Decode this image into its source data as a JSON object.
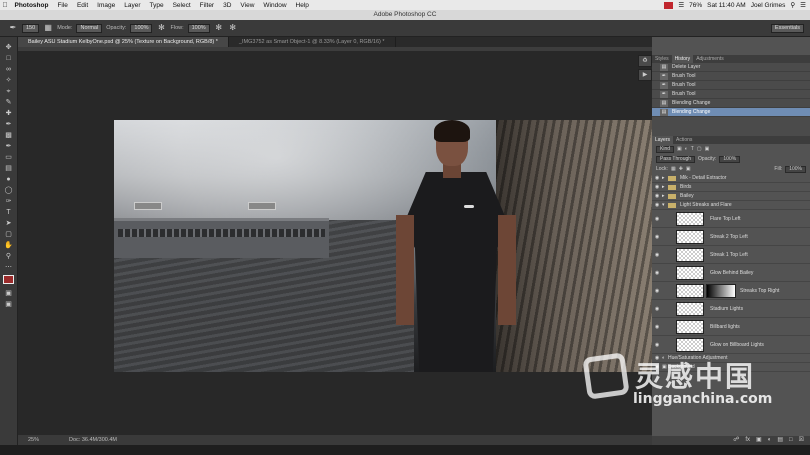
{
  "menubar": {
    "apple_icon": "apple-logo-icon",
    "items": [
      "Photoshop",
      "File",
      "Edit",
      "Image",
      "Layer",
      "Type",
      "Select",
      "Filter",
      "3D",
      "View",
      "Window",
      "Help"
    ],
    "status": {
      "battery": "76%",
      "clock": "Sat 11:40 AM",
      "user": "Joel Grimes"
    }
  },
  "window": {
    "title": "Adobe Photoshop CC"
  },
  "options": {
    "brush_size": "150",
    "mode_label": "Mode:",
    "mode_value": "Normal",
    "opacity_label": "Opacity:",
    "opacity_value": "100%",
    "flow_label": "Flow:",
    "flow_value": "100%",
    "workspace": "Essentials"
  },
  "tabs": [
    {
      "label": "Bailey ASU Stadium KelbyOne.psd @ 25% (Texture on Background, RGB/8) *",
      "active": true
    },
    {
      "label": "_IMG3752 as Smart Object-1 @ 8.33% (Layer 0, RGB/16) *",
      "active": false
    }
  ],
  "status_bar": {
    "zoom": "25%",
    "doc": "Doc: 36.4M/300.4M"
  },
  "history_panel": {
    "tabs": [
      "Styles",
      "History",
      "Adjustments"
    ],
    "active_tab": "History",
    "items": [
      {
        "label": "Delete Layer",
        "icon": "layer-icon"
      },
      {
        "label": "Brush Tool",
        "icon": "brush-icon"
      },
      {
        "label": "Brush Tool",
        "icon": "brush-icon"
      },
      {
        "label": "Brush Tool",
        "icon": "brush-icon"
      },
      {
        "label": "Blending Change",
        "icon": "layer-icon"
      },
      {
        "label": "Blending Change",
        "icon": "layer-icon",
        "selected": true
      }
    ]
  },
  "layers_panel": {
    "tabs": [
      "Layers",
      "Actions"
    ],
    "active_tab": "Layers",
    "kind": "Kind",
    "blend_mode": "Pass Through",
    "opacity_label": "Opacity:",
    "opacity_value": "100%",
    "lock_label": "Lock:",
    "fill_label": "Fill:",
    "fill_value": "100%",
    "groups": [
      {
        "label": "Mik - Detail Extractor"
      },
      {
        "label": "Birds"
      },
      {
        "label": "Bailey"
      },
      {
        "label": "Light Streaks and Flare",
        "open": true
      }
    ],
    "layers": [
      {
        "label": "Flare Top Left",
        "has_mask": false
      },
      {
        "label": "Streak 2 Top Left",
        "has_mask": false
      },
      {
        "label": "Streak 1 Top Left",
        "has_mask": false
      },
      {
        "label": "Glow Behind Bailey",
        "has_mask": false
      },
      {
        "label": "Streaks Top Right",
        "has_mask": true
      },
      {
        "label": "Stadium Lights",
        "has_mask": false
      },
      {
        "label": "Billbard lights",
        "has_mask": false
      },
      {
        "label": "Glow on Billboard Lights",
        "has_mask": false
      }
    ],
    "footer_layers": [
      "Hue/Saturation Adjustment",
      "Background"
    ]
  },
  "watermark": {
    "title": "灵感中国",
    "url": "lingganchina.com"
  },
  "colors": {
    "panel_bg": "#535353",
    "selection": "#6f8db4",
    "menubar_bg": "#e9e9e9"
  }
}
